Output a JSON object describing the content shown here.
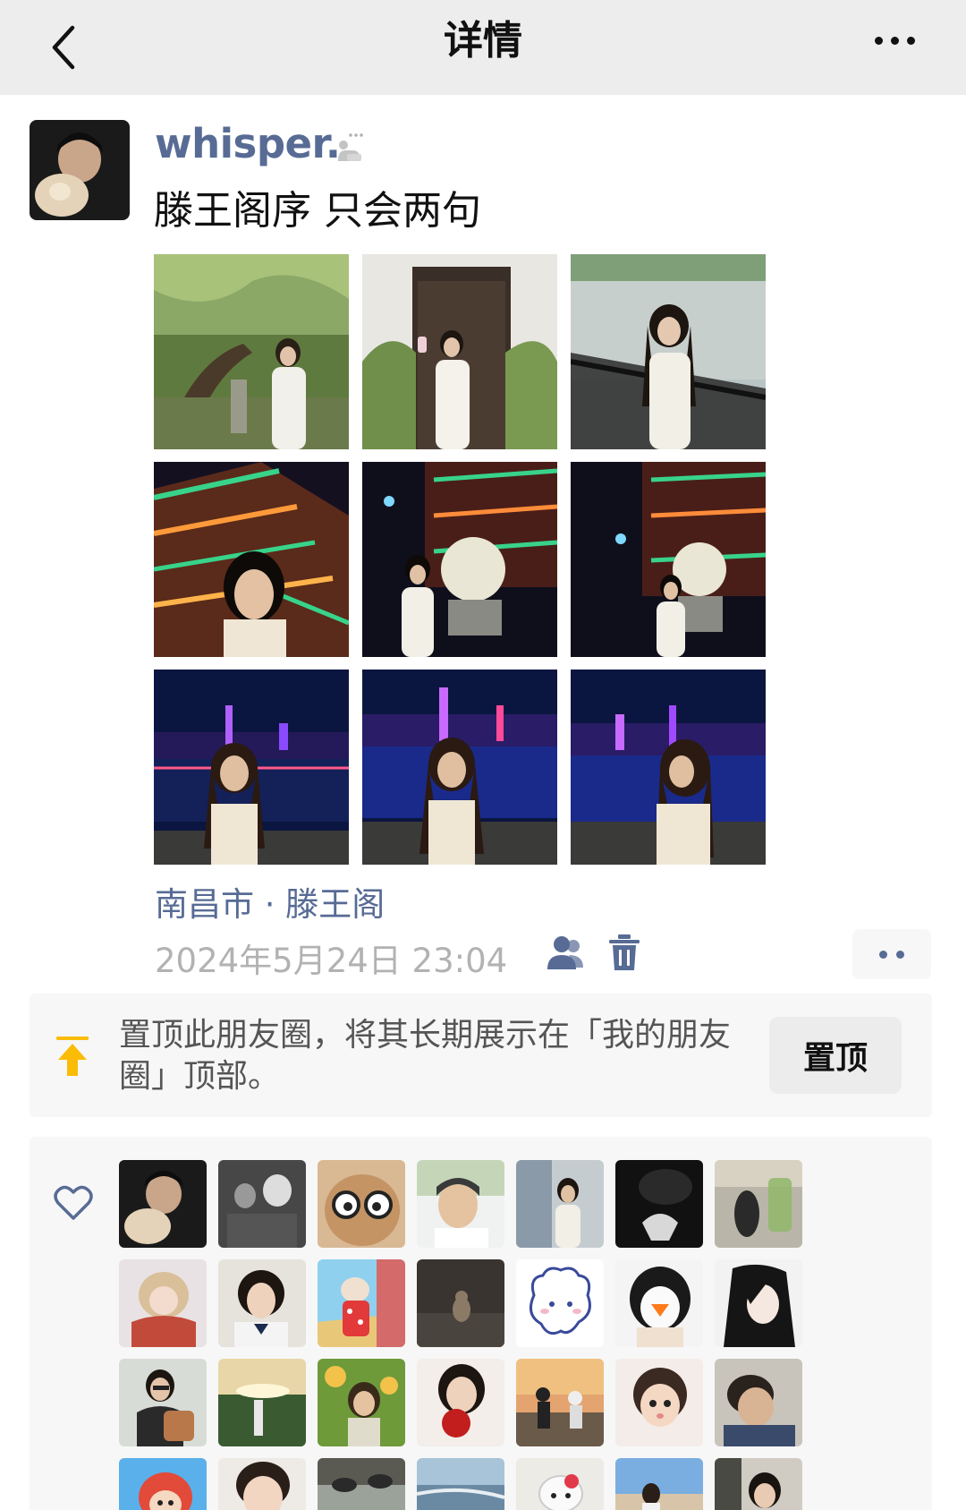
{
  "navbar": {
    "title": "详情",
    "back_icon": "chevron-left-icon",
    "more_icon": "more-dots-icon"
  },
  "post": {
    "username": "whisper.",
    "text": "滕王阁序 只会两句",
    "location": "南昌市 · 滕王阁",
    "timestamp": "2024年5月24日 23:04",
    "photo_count": 9,
    "photo_scenes": [
      "forest-tree",
      "doorway-garden",
      "lakeside-rail",
      "pavilion-night",
      "pavilion-moon",
      "pavilion-moon",
      "city-lights-river",
      "city-lights-river",
      "city-lights-river"
    ]
  },
  "pin": {
    "description": "置顶此朋友圈，将其长期展示在「我的朋友圈」顶部。",
    "button_label": "置顶"
  },
  "likes": {
    "icon": "heart-outline-icon",
    "visible_avatar_count": 28
  },
  "colors": {
    "link": "#576b95",
    "muted": "#b2b2b2",
    "pin_accent": "#fbbc05",
    "navbar_bg": "#ededed",
    "card_bg": "#f7f7f7"
  }
}
